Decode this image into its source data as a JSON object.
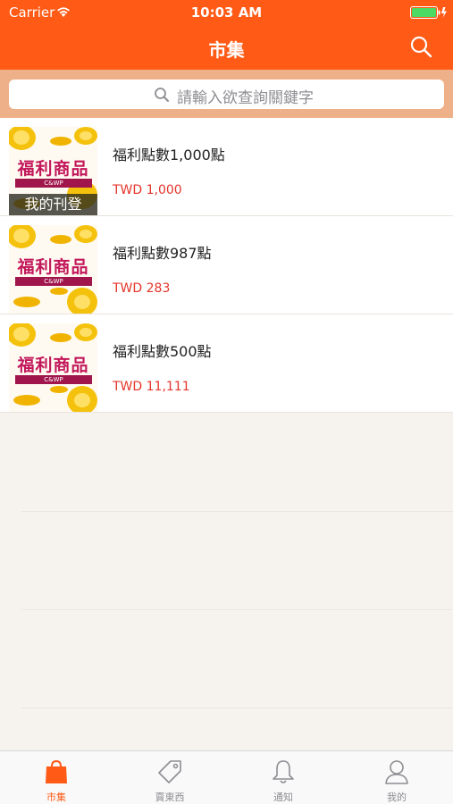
{
  "status_bar": {
    "carrier": "Carrier",
    "time": "10:03 AM",
    "wifi_icon": "wifi-icon",
    "battery_icon": "battery-icon"
  },
  "nav": {
    "title": "市集",
    "search_icon": "search-icon"
  },
  "search": {
    "placeholder": "請輸入欲查詢關鍵字"
  },
  "listings": [
    {
      "name": "福利點數1,000點",
      "price": "TWD 1,000",
      "thumb_title": "福利商品",
      "thumb_sub": "C&WP",
      "badge": "我的刊登"
    },
    {
      "name": "福利點數987點",
      "price": "TWD 283",
      "thumb_title": "福利商品",
      "thumb_sub": "C&WP"
    },
    {
      "name": "福利點數500點",
      "price": "TWD 11,111",
      "thumb_title": "福利商品",
      "thumb_sub": "C&WP"
    }
  ],
  "tabs": [
    {
      "label": "市集",
      "icon": "shopping-bag-icon",
      "active": true
    },
    {
      "label": "賣東西",
      "icon": "price-tag-icon",
      "active": false
    },
    {
      "label": "通知",
      "icon": "bell-icon",
      "active": false
    },
    {
      "label": "我的",
      "icon": "person-icon",
      "active": false
    }
  ],
  "colors": {
    "accent": "#ff5a16",
    "price": "#e4352b",
    "search_band": "#eeb088",
    "background": "#f6f2ee"
  }
}
